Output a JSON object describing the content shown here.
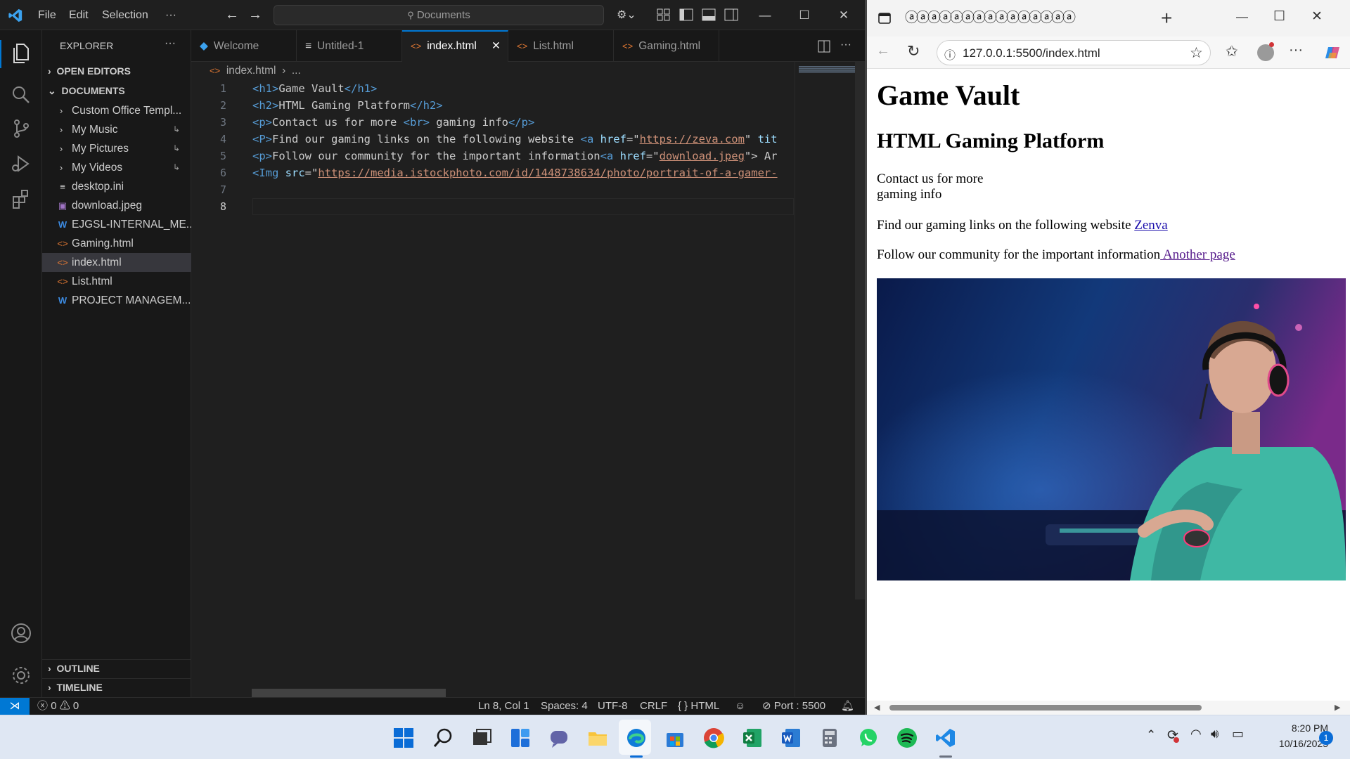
{
  "vscode": {
    "menu": [
      "File",
      "Edit",
      "Selection"
    ],
    "more_menu": "···",
    "search_placeholder": "Documents",
    "explorer_title": "EXPLORER",
    "explorer_more": "···",
    "sections": {
      "open_editors": "OPEN EDITORS",
      "documents": "DOCUMENTS",
      "outline": "OUTLINE",
      "timeline": "TIMELINE"
    },
    "files": [
      {
        "label": "Custom Office Templ...",
        "kind": "folder"
      },
      {
        "label": "My Music",
        "kind": "folder-link"
      },
      {
        "label": "My Pictures",
        "kind": "folder-link"
      },
      {
        "label": "My Videos",
        "kind": "folder-link"
      },
      {
        "label": "desktop.ini",
        "kind": "file"
      },
      {
        "label": "download.jpeg",
        "kind": "image"
      },
      {
        "label": "EJGSL-INTERNAL_ME...",
        "kind": "word"
      },
      {
        "label": "Gaming.html",
        "kind": "html"
      },
      {
        "label": "index.html",
        "kind": "html",
        "selected": true
      },
      {
        "label": "List.html",
        "kind": "html"
      },
      {
        "label": "PROJECT MANAGEM...",
        "kind": "word"
      }
    ],
    "tabs": [
      {
        "label": "Welcome",
        "kind": "vscode"
      },
      {
        "label": "Untitled-1",
        "kind": "text"
      },
      {
        "label": "index.html",
        "kind": "html",
        "active": true
      },
      {
        "label": "List.html",
        "kind": "html"
      },
      {
        "label": "Gaming.html",
        "kind": "html"
      }
    ],
    "breadcrumb": {
      "file": "index.html",
      "rest": "..."
    },
    "line_numbers": [
      "1",
      "2",
      "3",
      "4",
      "5",
      "6",
      "7",
      "8"
    ],
    "code_lines": [
      [
        {
          "t": "tag",
          "v": "<h1>"
        },
        {
          "t": "plain",
          "v": "Game Vault"
        },
        {
          "t": "tag",
          "v": "</h1>"
        }
      ],
      [
        {
          "t": "tag",
          "v": "<h2>"
        },
        {
          "t": "plain",
          "v": "HTML Gaming Platform"
        },
        {
          "t": "tag",
          "v": "</h2>"
        }
      ],
      [
        {
          "t": "tag",
          "v": "<p>"
        },
        {
          "t": "plain",
          "v": "Contact us for more "
        },
        {
          "t": "tag",
          "v": "<br>"
        },
        {
          "t": "plain",
          "v": " gaming info"
        },
        {
          "t": "tag",
          "v": "</p>"
        }
      ],
      [
        {
          "t": "tag",
          "v": "<P>"
        },
        {
          "t": "plain",
          "v": "Find our gaming links on the following website "
        },
        {
          "t": "tag",
          "v": "<a "
        },
        {
          "t": "attr",
          "v": "href"
        },
        {
          "t": "plain",
          "v": "=\""
        },
        {
          "t": "str",
          "v": "https://zeva.com"
        },
        {
          "t": "plain",
          "v": "\" "
        },
        {
          "t": "attr",
          "v": "tit"
        }
      ],
      [
        {
          "t": "tag",
          "v": "<p>"
        },
        {
          "t": "plain",
          "v": "Follow our community for the important information"
        },
        {
          "t": "tag",
          "v": "<a "
        },
        {
          "t": "attr",
          "v": "href"
        },
        {
          "t": "plain",
          "v": "=\""
        },
        {
          "t": "str",
          "v": "download.jpeg"
        },
        {
          "t": "plain",
          "v": "\"> Ar"
        }
      ],
      [
        {
          "t": "tag",
          "v": "<Img "
        },
        {
          "t": "attr",
          "v": "src"
        },
        {
          "t": "plain",
          "v": "=\""
        },
        {
          "t": "str",
          "v": "https://media.istockphoto.com/id/1448738634/photo/portrait-of-a-gamer-"
        }
      ],
      [],
      []
    ],
    "status": {
      "errors": "0",
      "warnings": "0",
      "position": "Ln 8, Col 1",
      "spaces": "Spaces: 4",
      "encoding": "UTF-8",
      "eol": "CRLF",
      "language": "HTML",
      "language_prefix": "{ }",
      "port": "Port : 5500"
    },
    "accent": "#0078d4"
  },
  "browser": {
    "tab_title": "ⓐⓐⓐⓐⓐⓐⓐⓐⓐⓐⓐⓐⓐⓐⓐ",
    "new_tab": "+",
    "url": "127.0.0.1:5500/index.html",
    "more": "···",
    "page": {
      "h1": "Game Vault",
      "h2": "HTML Gaming Platform",
      "p1_line1": "Contact us for more",
      "p1_line2": "gaming info",
      "p2_text": "Find our gaming links on the following website ",
      "p2_link": "Zenva",
      "p3_text": "Follow our community for the important information",
      "p3_link": " Another page"
    }
  },
  "taskbar": {
    "time": "8:20 PM",
    "date": "10/16/2025",
    "notification_count": "1"
  }
}
